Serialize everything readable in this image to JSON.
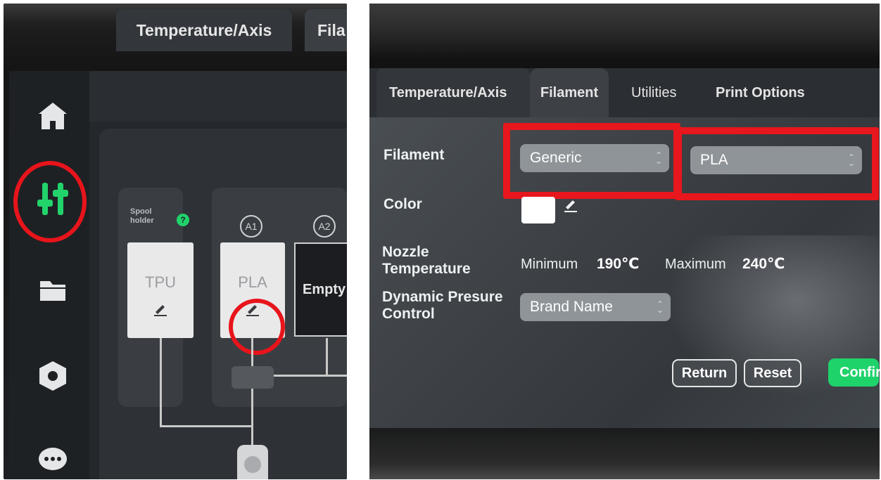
{
  "left_photo": {
    "tabs": [
      {
        "label": "Temperature/Axis"
      },
      {
        "label": "Fila"
      }
    ],
    "spool_holder": {
      "label_line1": "Spool",
      "label_line2": "holder",
      "help_badge": "?"
    },
    "slots": [
      {
        "label": "TPU"
      },
      {
        "label": "PLA"
      },
      {
        "label": "Empty"
      }
    ],
    "slot_badges": [
      "A1",
      "A2"
    ],
    "nav_icons": [
      "home-icon",
      "sliders-icon",
      "folder-icon",
      "settings-hex-icon",
      "chat-icon"
    ],
    "colors": {
      "active_nav": "#22d36b",
      "highlight": "#e8141b"
    }
  },
  "right_photo": {
    "tabs": [
      {
        "label": "Temperature/Axis"
      },
      {
        "label": "Filament"
      },
      {
        "label": "Utilities"
      },
      {
        "label": "Print Options"
      }
    ],
    "fields": {
      "filament_label": "Filament",
      "filament_vendor": "Generic",
      "filament_type": "PLA",
      "color_label": "Color",
      "nozzle_label_line1": "Nozzle",
      "nozzle_label_line2": "Temperature",
      "min_label": "Minimum",
      "min_value": "190℃",
      "max_label": "Maximum",
      "max_value": "240℃",
      "pressure_label_line1": "Dynamic Presure",
      "pressure_label_line2": "Control",
      "pressure_value": "Brand Name"
    },
    "buttons": {
      "return": "Return",
      "reset": "Reset",
      "confirm": "Confirm"
    },
    "colors": {
      "confirm": "#1fd36b",
      "highlight": "#e8161d",
      "swatch": "#ffffff"
    }
  }
}
